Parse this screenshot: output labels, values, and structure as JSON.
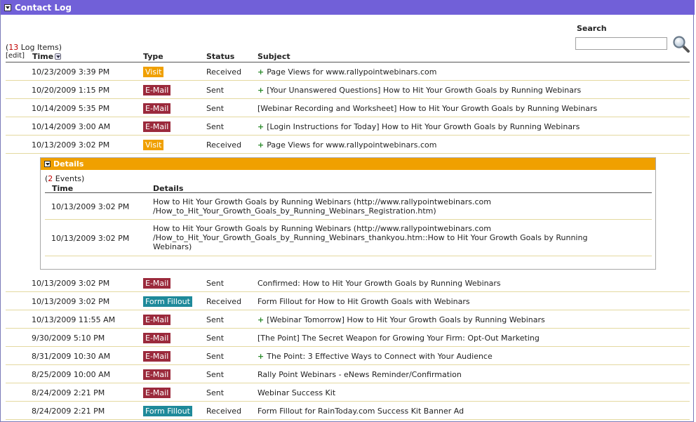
{
  "panel": {
    "title": "Contact Log"
  },
  "search": {
    "label": "Search",
    "value": "",
    "placeholder": ""
  },
  "log": {
    "count_open": "(",
    "count": "13",
    "count_label": " Log Items)",
    "edit": "[edit]",
    "headers": {
      "time": "Time",
      "type": "Type",
      "status": "Status",
      "subject": "Subject"
    }
  },
  "rows_top": [
    {
      "time": "10/23/2009 3:39 PM",
      "type": "Visit",
      "status": "Received",
      "plus": "+",
      "subject": "Page Views for www.rallypointwebinars.com"
    },
    {
      "time": "10/20/2009 1:15 PM",
      "type": "E-Mail",
      "status": "Sent",
      "plus": "+",
      "subject": "[Your Unanswered Questions] How to Hit Your Growth Goals by Running Webinars"
    },
    {
      "time": "10/14/2009 5:35 PM",
      "type": "E-Mail",
      "status": "Sent",
      "plus": "",
      "subject": "[Webinar Recording and Worksheet] How to Hit Your Growth Goals by Running Webinars"
    },
    {
      "time": "10/14/2009 3:00 AM",
      "type": "E-Mail",
      "status": "Sent",
      "plus": "+",
      "subject": "[Login Instructions for Today] How to Hit Your Growth Goals by Running Webinars"
    },
    {
      "time": "10/13/2009 3:02 PM",
      "type": "Visit",
      "status": "Received",
      "plus": "+",
      "subject": "Page Views for www.rallypointwebinars.com"
    }
  ],
  "details": {
    "title": "Details",
    "count_open": "(",
    "count": "2",
    "count_label": " Events)",
    "headers": {
      "time": "Time",
      "details": "Details"
    },
    "rows": [
      {
        "time": "10/13/2009 3:02 PM",
        "line1": "How to Hit Your Growth Goals by Running Webinars (http://www.rallypointwebinars.com",
        "line2": "/How_to_Hit_Your_Growth_Goals_by_Running_Webinars_Registration.htm)",
        "line3": ""
      },
      {
        "time": "10/13/2009 3:02 PM",
        "line1": "How to Hit Your Growth Goals by Running Webinars (http://www.rallypointwebinars.com",
        "line2": "/How_to_Hit_Your_Growth_Goals_by_Running_Webinars_thankyou.htm::How to Hit Your Growth Goals by Running",
        "line3": "Webinars)"
      }
    ]
  },
  "rows_bottom": [
    {
      "time": "10/13/2009 3:02 PM",
      "type": "E-Mail",
      "status": "Sent",
      "plus": "",
      "subject": "Confirmed: How to Hit Your Growth Goals by Running Webinars"
    },
    {
      "time": "10/13/2009 3:02 PM",
      "type": "Form Fillout",
      "status": "Received",
      "plus": "",
      "subject": "Form Fillout for How to Hit Growth Goals with Webinars"
    },
    {
      "time": "10/13/2009 11:55 AM",
      "type": "E-Mail",
      "status": "Sent",
      "plus": "+",
      "subject": "[Webinar Tomorrow] How to Hit Your Growth Goals by Running Webinars"
    },
    {
      "time": "9/30/2009 5:10 PM",
      "type": "E-Mail",
      "status": "Sent",
      "plus": "",
      "subject": "[The Point] The Secret Weapon for Growing Your Firm: Opt-Out Marketing"
    },
    {
      "time": "8/31/2009 10:30 AM",
      "type": "E-Mail",
      "status": "Sent",
      "plus": "+",
      "subject": "The Point: 3 Effective Ways to Connect with Your Audience"
    },
    {
      "time": "8/25/2009 10:00 AM",
      "type": "E-Mail",
      "status": "Sent",
      "plus": "",
      "subject": "Rally Point Webinars - eNews Reminder/Confirmation"
    },
    {
      "time": "8/24/2009 2:21 PM",
      "type": "E-Mail",
      "status": "Sent",
      "plus": "",
      "subject": "Webinar Success Kit"
    },
    {
      "time": "8/24/2009 2:21 PM",
      "type": "Form Fillout",
      "status": "Received",
      "plus": "",
      "subject": "Form Fillout for RainToday.com Success Kit Banner Ad"
    }
  ],
  "colors": {
    "title_bar": "#7160d8",
    "details_bar": "#f0a000",
    "badge_visit": "#f0a000",
    "badge_email": "#9b2a3c",
    "badge_form": "#1f8a9a",
    "plus": "#2a8a2a",
    "count": "#c00000"
  },
  "icons": {
    "collapse": "collapse-arrow-icon",
    "sort": "sort-arrow-icon",
    "search": "magnifier-icon"
  }
}
